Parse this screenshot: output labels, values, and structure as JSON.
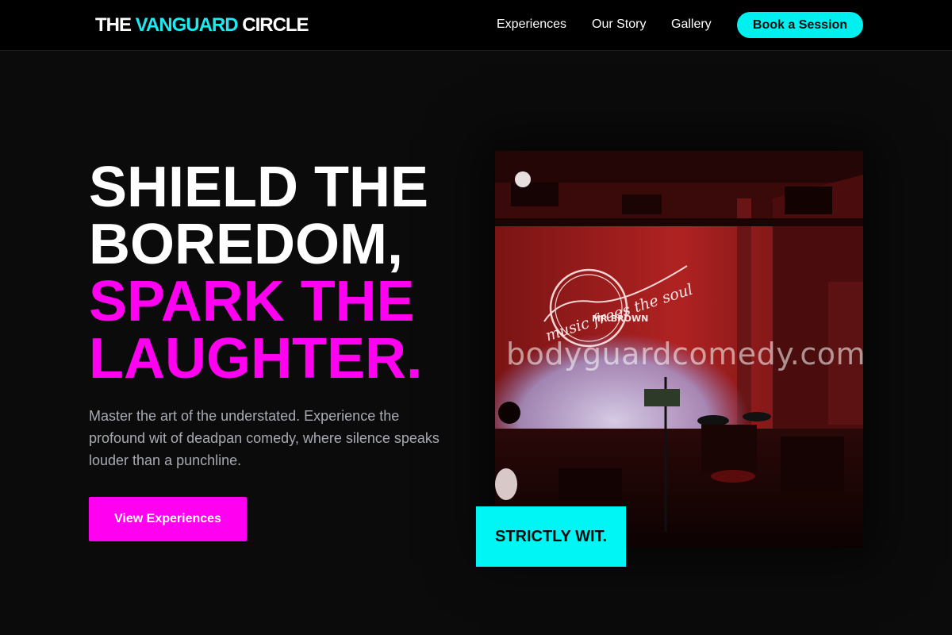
{
  "nav": {
    "brand_prefix": "THE ",
    "brand_accent": "VANGUARD",
    "brand_suffix": " CIRCLE",
    "links": [
      "Experiences",
      "Our Story",
      "Gallery"
    ],
    "cta_label": "Book a Session"
  },
  "hero": {
    "headline_white": [
      "SHIELD THE",
      "BOREDOM,"
    ],
    "headline_pink": [
      "SPARK THE",
      "LAUGHTER."
    ],
    "subtitle": "Master the art of the understated. Experience the profound wit of deadpan comedy, where silence speaks louder than a punchline.",
    "cta_label": "View Experiences",
    "badge": "STRICTLY WIT.",
    "watermark": "bodyguardcomedy.com",
    "neon_sign_script": "music frees the soul",
    "neon_sign_name": "MR.BROWN"
  },
  "colors": {
    "background": "#0b0b0c",
    "accent_cyan": "#00f0f0",
    "accent_pink": "#ff00f0",
    "muted_text": "#a8aab2"
  }
}
